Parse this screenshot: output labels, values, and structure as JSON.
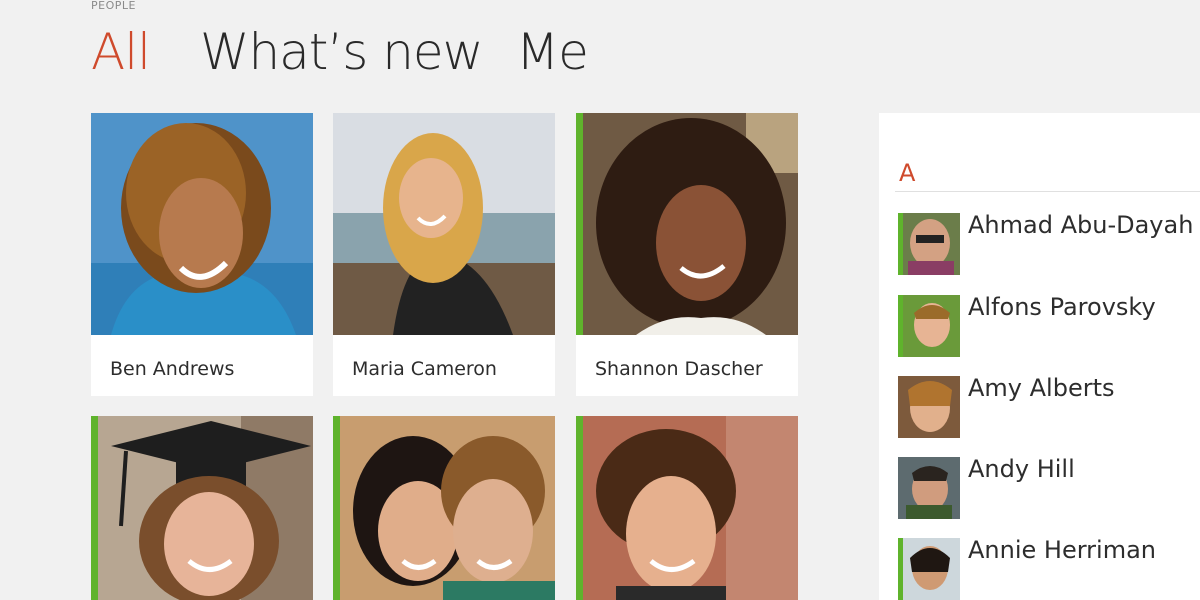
{
  "app": {
    "title": "PEOPLE"
  },
  "tabs": [
    {
      "label": "All",
      "active": true
    },
    {
      "label": "What’s new",
      "active": false
    },
    {
      "label": "Me",
      "active": false
    }
  ],
  "tiles": [
    {
      "name": "Ben Andrews",
      "has_accent": false
    },
    {
      "name": "Maria Cameron",
      "has_accent": false
    },
    {
      "name": "Shannon Dascher",
      "has_accent": true
    },
    {
      "name": "",
      "has_accent": true
    },
    {
      "name": "",
      "has_accent": true
    },
    {
      "name": "",
      "has_accent": true
    }
  ],
  "alpha_list": {
    "letter": "A",
    "contacts": [
      {
        "name": "Ahmad Abu-Dayah",
        "has_accent": true
      },
      {
        "name": "Alfons Parovsky",
        "has_accent": true
      },
      {
        "name": "Amy Alberts",
        "has_accent": false
      },
      {
        "name": "Andy Hill",
        "has_accent": false
      },
      {
        "name": "Annie Herriman",
        "has_accent": true
      }
    ]
  },
  "colors": {
    "accent": "#cf4a2c",
    "tile_accent": "#5fb32c",
    "background": "#f1f1f1"
  }
}
